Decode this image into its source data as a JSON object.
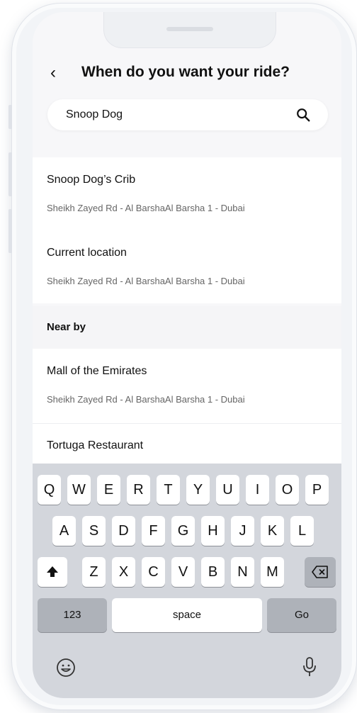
{
  "header": {
    "back_icon": "chevron-left-icon",
    "title": "When do you want your ride?"
  },
  "search": {
    "value": "Snoop Dog",
    "placeholder": "",
    "icon": "search-icon"
  },
  "results": [
    {
      "name": "Snoop Dog’s Crib",
      "address": "Sheikh Zayed Rd - Al BarshaAl Barsha 1 - Dubai"
    },
    {
      "name": "Current location",
      "address": "Sheikh Zayed Rd - Al BarshaAl Barsha 1 - Dubai"
    }
  ],
  "nearby": {
    "section_label": "Near by",
    "items": [
      {
        "name": "Mall of the Emirates",
        "address": "Sheikh Zayed Rd - Al BarshaAl Barsha 1 - Dubai"
      },
      {
        "name": "Tortuga Restaurant",
        "address": ""
      }
    ]
  },
  "keyboard": {
    "row1": [
      "Q",
      "W",
      "E",
      "R",
      "T",
      "Y",
      "U",
      "I",
      "O",
      "P"
    ],
    "row2": [
      "A",
      "S",
      "D",
      "F",
      "G",
      "H",
      "J",
      "K",
      "L"
    ],
    "row3": [
      "Z",
      "X",
      "C",
      "V",
      "B",
      "N",
      "M"
    ],
    "numbers_label": "123",
    "space_label": "space",
    "go_label": "Go",
    "shift_icon": "shift-icon",
    "backspace_icon": "backspace-icon",
    "emoji_icon": "emoji-icon",
    "mic_icon": "microphone-icon"
  }
}
